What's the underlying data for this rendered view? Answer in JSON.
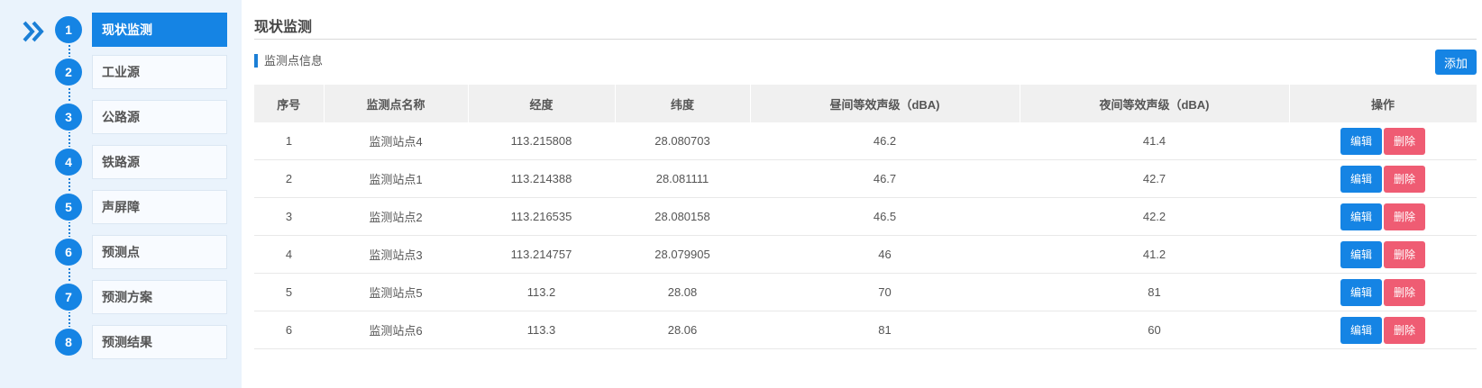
{
  "sidebar": {
    "collapse_icon": "double-chevron-right-icon",
    "steps": [
      {
        "num": "1",
        "label": "现状监测",
        "active": true
      },
      {
        "num": "2",
        "label": "工业源",
        "active": false
      },
      {
        "num": "3",
        "label": "公路源",
        "active": false
      },
      {
        "num": "4",
        "label": "铁路源",
        "active": false
      },
      {
        "num": "5",
        "label": "声屏障",
        "active": false
      },
      {
        "num": "6",
        "label": "预测点",
        "active": false
      },
      {
        "num": "7",
        "label": "预测方案",
        "active": false
      },
      {
        "num": "8",
        "label": "预测结果",
        "active": false
      }
    ]
  },
  "main": {
    "page_title": "现状监测",
    "section_title": "监测点信息",
    "add_label": "添加",
    "table": {
      "headers": [
        "序号",
        "监测点名称",
        "经度",
        "纬度",
        "昼间等效声级（dBA)",
        "夜间等效声级（dBA)",
        "操作"
      ],
      "rows": [
        {
          "no": "1",
          "name": "监测站点4",
          "lng": "113.215808",
          "lat": "28.080703",
          "day": "46.2",
          "night": "41.4"
        },
        {
          "no": "2",
          "name": "监测站点1",
          "lng": "113.214388",
          "lat": "28.081111",
          "day": "46.7",
          "night": "42.7"
        },
        {
          "no": "3",
          "name": "监测站点2",
          "lng": "113.216535",
          "lat": "28.080158",
          "day": "46.5",
          "night": "42.2"
        },
        {
          "no": "4",
          "name": "监测站点3",
          "lng": "113.214757",
          "lat": "28.079905",
          "day": "46",
          "night": "41.2"
        },
        {
          "no": "5",
          "name": "监测站点5",
          "lng": "113.2",
          "lat": "28.08",
          "day": "70",
          "night": "81"
        },
        {
          "no": "6",
          "name": "监测站点6",
          "lng": "113.3",
          "lat": "28.06",
          "day": "81",
          "night": "60"
        }
      ],
      "edit_label": "编辑",
      "delete_label": "删除"
    }
  },
  "colors": {
    "accent": "#1584e4",
    "danger": "#ef5c73",
    "sidebar_bg": "#eaf3fc",
    "header_bg": "#f0f0f0"
  }
}
